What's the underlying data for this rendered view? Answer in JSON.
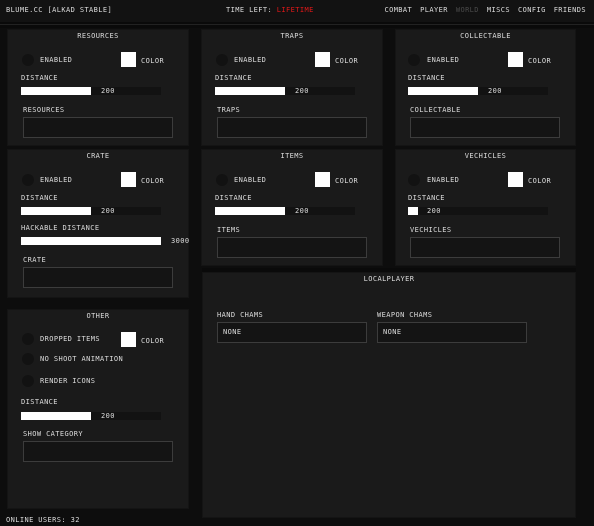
{
  "header": {
    "brand": "BLUME.CC [ALKAD STABLE]",
    "time_left_label": "TIME LEFT:",
    "time_left_value": "LIFETIME",
    "nav": [
      "COMBAT",
      "PLAYER",
      "WORLD",
      "MISCS",
      "CONFIG",
      "FRIENDS"
    ],
    "active_nav": "WORLD"
  },
  "colors": {
    "background": "#0d0d0d",
    "panel": "#1a1a1a",
    "accent_red": "#e01818",
    "slider_fill": "#ffffff"
  },
  "panels": {
    "resources": {
      "title": "RESOURCES",
      "enabled": "ENABLED",
      "color": "COLOR",
      "distance": "DISTANCE",
      "distance_value": "200",
      "distance_fill": 0.5,
      "list_label": "RESOURCES"
    },
    "traps": {
      "title": "TRAPS",
      "enabled": "ENABLED",
      "color": "COLOR",
      "distance": "DISTANCE",
      "distance_value": "200",
      "distance_fill": 0.5,
      "list_label": "TRAPS"
    },
    "collectable": {
      "title": "COLLECTABLE",
      "enabled": "ENABLED",
      "color": "COLOR",
      "distance": "DISTANCE",
      "distance_value": "200",
      "distance_fill": 0.5,
      "list_label": "COLLECTABLE"
    },
    "crate": {
      "title": "CRATE",
      "enabled": "ENABLED",
      "color": "COLOR",
      "distance": "DISTANCE",
      "distance_value": "200",
      "distance_fill": 0.5,
      "hackable": "HACKABLE DISTANCE",
      "hackable_value": "3000",
      "hackable_fill": 1.0,
      "list_label": "CRATE"
    },
    "items": {
      "title": "ITEMS",
      "enabled": "ENABLED",
      "color": "COLOR",
      "distance": "DISTANCE",
      "distance_value": "200",
      "distance_fill": 0.5,
      "list_label": "ITEMS"
    },
    "vehicles": {
      "title": "VECHICLES",
      "enabled": "ENABLED",
      "color": "COLOR",
      "distance": "DISTANCE",
      "distance_value": "200",
      "distance_fill": 0.07,
      "list_label": "VECHICLES"
    },
    "other": {
      "title": "OTHER",
      "dropped": "DROPPED ITEMS",
      "color": "COLOR",
      "no_shoot": "NO SHOOT ANIMATION",
      "render_icons": "RENDER ICONS",
      "distance": "DISTANCE",
      "distance_value": "200",
      "distance_fill": 0.5,
      "show_category": "SHOW CATEGORY"
    },
    "localplayer": {
      "title": "LOCALPLAYER",
      "hand_chams": "HAND CHAMS",
      "hand_value": "NONE",
      "weapon_chams": "WEAPON CHAMS",
      "weapon_value": "NONE"
    }
  },
  "footer": {
    "online_users": "ONLINE USERS: 32"
  }
}
